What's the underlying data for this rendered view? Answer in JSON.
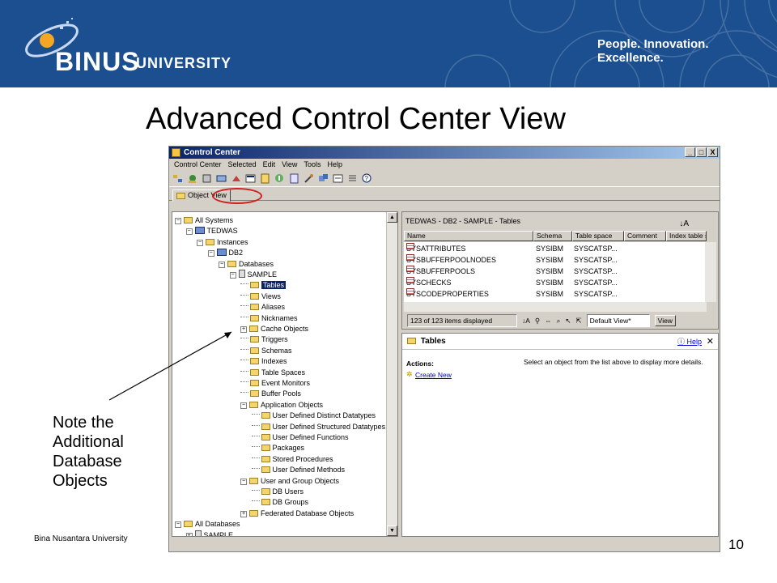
{
  "banner": {
    "logo_word": "BINUS",
    "logo_sub": "UNIVERSITY",
    "slogan": "People. Innovation. Excellence."
  },
  "slide": {
    "title": "Advanced Control Center View",
    "note": "Note the Additional Database Objects",
    "footer": "Bina Nusantara University",
    "page_number": "10"
  },
  "window": {
    "title": "Control Center",
    "controls": [
      "_",
      "□",
      "X"
    ],
    "menu": [
      "Control Center",
      "Selected",
      "Edit",
      "View",
      "Tools",
      "Help"
    ],
    "tab": "Object View"
  },
  "tree": [
    {
      "label": "All Systems",
      "depth": 0,
      "exp": "−",
      "icon": "folder"
    },
    {
      "label": "TEDWAS",
      "depth": 1,
      "exp": "−",
      "icon": "system"
    },
    {
      "label": "Instances",
      "depth": 2,
      "exp": "−",
      "icon": "folder"
    },
    {
      "label": "DB2",
      "depth": 3,
      "exp": "−",
      "icon": "system"
    },
    {
      "label": "Databases",
      "depth": 4,
      "exp": "−",
      "icon": "folder"
    },
    {
      "label": "SAMPLE",
      "depth": 5,
      "exp": "−",
      "icon": "db"
    },
    {
      "label": "Tables",
      "depth": 6,
      "exp": "",
      "icon": "folder",
      "selected": true
    },
    {
      "label": "Views",
      "depth": 6,
      "exp": "",
      "icon": "folder"
    },
    {
      "label": "Aliases",
      "depth": 6,
      "exp": "",
      "icon": "folder"
    },
    {
      "label": "Nicknames",
      "depth": 6,
      "exp": "",
      "icon": "folder"
    },
    {
      "label": "Cache Objects",
      "depth": 6,
      "exp": "+",
      "icon": "folder"
    },
    {
      "label": "Triggers",
      "depth": 6,
      "exp": "",
      "icon": "folder"
    },
    {
      "label": "Schemas",
      "depth": 6,
      "exp": "",
      "icon": "folder"
    },
    {
      "label": "Indexes",
      "depth": 6,
      "exp": "",
      "icon": "folder"
    },
    {
      "label": "Table Spaces",
      "depth": 6,
      "exp": "",
      "icon": "folder"
    },
    {
      "label": "Event Monitors",
      "depth": 6,
      "exp": "",
      "icon": "folder"
    },
    {
      "label": "Buffer Pools",
      "depth": 6,
      "exp": "",
      "icon": "folder"
    },
    {
      "label": "Application Objects",
      "depth": 6,
      "exp": "−",
      "icon": "folder"
    },
    {
      "label": "User Defined Distinct Datatypes",
      "depth": 7,
      "exp": "",
      "icon": "folder"
    },
    {
      "label": "User Defined Structured Datatypes",
      "depth": 7,
      "exp": "",
      "icon": "folder"
    },
    {
      "label": "User Defined Functions",
      "depth": 7,
      "exp": "",
      "icon": "folder"
    },
    {
      "label": "Packages",
      "depth": 7,
      "exp": "",
      "icon": "folder"
    },
    {
      "label": "Stored Procedures",
      "depth": 7,
      "exp": "",
      "icon": "folder"
    },
    {
      "label": "User Defined Methods",
      "depth": 7,
      "exp": "",
      "icon": "folder"
    },
    {
      "label": "User and Group Objects",
      "depth": 6,
      "exp": "−",
      "icon": "folder"
    },
    {
      "label": "DB Users",
      "depth": 7,
      "exp": "",
      "icon": "folder"
    },
    {
      "label": "DB Groups",
      "depth": 7,
      "exp": "",
      "icon": "folder"
    },
    {
      "label": "Federated Database Objects",
      "depth": 6,
      "exp": "+",
      "icon": "folder"
    },
    {
      "label": "All Databases",
      "depth": 0,
      "exp": "−",
      "icon": "folder"
    },
    {
      "label": "SAMPLE",
      "depth": 1,
      "exp": "+",
      "icon": "db"
    }
  ],
  "list": {
    "header": "TEDWAS - DB2 - SAMPLE - Tables",
    "columns": [
      "Name",
      "Schema",
      "Table space",
      "Comment",
      "Index table s"
    ],
    "rows": [
      [
        "SYSATTRIBUTES",
        "SYSIBM",
        "SYSCATSP..."
      ],
      [
        "SYSBUFFERPOOLNODES",
        "SYSIBM",
        "SYSCATSP..."
      ],
      [
        "SYSBUFFERPOOLS",
        "SYSIBM",
        "SYSCATSP..."
      ],
      [
        "SYSCHECKS",
        "SYSIBM",
        "SYSCATSP..."
      ],
      [
        "SYSCODEPROPERTIES",
        "SYSIBM",
        "SYSCATSP..."
      ]
    ],
    "status": "123 of 123 items displayed",
    "view_select": "Default View*",
    "view_button": "View"
  },
  "details": {
    "title": "Tables",
    "help": "Help",
    "actions_label": "Actions:",
    "create_new": "Create New",
    "hint": "Select an object from the list above to display more details."
  }
}
